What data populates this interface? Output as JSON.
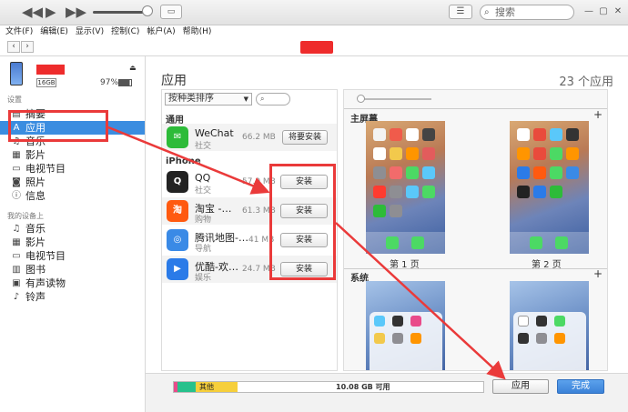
{
  "player": {
    "rewind_icon": "rewind-icon",
    "play_icon": "play-icon",
    "forward_icon": "forward-icon",
    "airplay_icon": "airplay-icon",
    "search_placeholder": "搜索"
  },
  "menu": [
    "文件(F)",
    "编辑(E)",
    "显示(V)",
    "控制(C)",
    "帐户(A)",
    "帮助(H)"
  ],
  "sidebar": {
    "capacity": "16GB",
    "battery": "97%",
    "settings_title": "设置",
    "settings_items": [
      {
        "label": "摘要",
        "icon": "summary-icon"
      },
      {
        "label": "应用",
        "icon": "apps-icon",
        "selected": true
      },
      {
        "label": "音乐",
        "icon": "music-icon"
      },
      {
        "label": "影片",
        "icon": "movies-icon"
      },
      {
        "label": "电视节目",
        "icon": "tv-icon"
      },
      {
        "label": "照片",
        "icon": "photos-icon"
      },
      {
        "label": "信息",
        "icon": "info-icon"
      }
    ],
    "device_title": "我的设备上",
    "device_items": [
      {
        "label": "音乐",
        "icon": "music-icon"
      },
      {
        "label": "影片",
        "icon": "movies-icon"
      },
      {
        "label": "电视节目",
        "icon": "tv-icon"
      },
      {
        "label": "图书",
        "icon": "books-icon"
      },
      {
        "label": "有声读物",
        "icon": "audiobooks-icon"
      },
      {
        "label": "铃声",
        "icon": "bell-icon"
      }
    ]
  },
  "main": {
    "title": "应用",
    "count": "23 个应用",
    "sort_label": "按种类排序",
    "group_general": "通用",
    "group_iphone": "iPhone",
    "general_apps": [
      {
        "name": "WeChat",
        "category": "社交",
        "size": "66.2 MB",
        "button": "将要安装",
        "color": "#2dbb39",
        "glyph": "✉"
      }
    ],
    "iphone_apps": [
      {
        "name": "QQ",
        "category": "社交",
        "size": "57.9 MB",
        "button": "安装",
        "color": "#222222",
        "glyph": "Q"
      },
      {
        "name": "淘宝 -…",
        "category": "购物",
        "size": "61.3 MB",
        "button": "安装",
        "color": "#ff5a10",
        "glyph": "淘"
      },
      {
        "name": "腾讯地图-…",
        "category": "导航",
        "size": "41 MB",
        "button": "安装",
        "color": "#3a8ae6",
        "glyph": "◎"
      },
      {
        "name": "优酷-欢…",
        "category": "娱乐",
        "size": "24.7 MB",
        "button": "安装",
        "color": "#2b7be8",
        "glyph": "▶"
      }
    ]
  },
  "home": {
    "home_title": "主屏幕",
    "page1": "第 1 页",
    "page2": "第 2 页",
    "system_title": "系统"
  },
  "storage": {
    "other_label": "其他",
    "free_label": "10.08 GB 可用",
    "colors": {
      "photos": "#f0a23a",
      "apps": "#27c18c",
      "music": "#e94b8a",
      "other": "#f6cf3b"
    }
  },
  "buttons": {
    "apply": "应用",
    "done": "完成"
  },
  "accent": "#3b8de0",
  "annotation_color": "#ea3a3a"
}
